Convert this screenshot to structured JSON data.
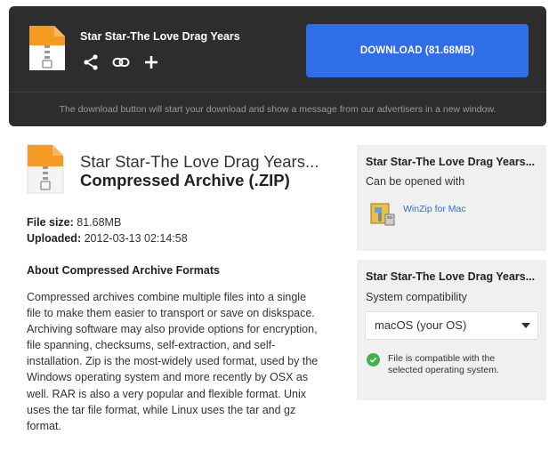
{
  "header": {
    "title": "Star Star-The Love Drag Years",
    "download_label": "DOWNLOAD (81.68MB)",
    "notice": "The download button will start your download and show a message from our advertisers in a new window.",
    "actions": [
      "share-icon",
      "link-icon",
      "plus-icon"
    ]
  },
  "file": {
    "name": "Star Star-The Love Drag Years...",
    "type": "Compressed Archive (.ZIP)",
    "size_label": "File size:",
    "size": "81.68MB",
    "uploaded_label": "Uploaded:",
    "uploaded": "2012-03-13 02:14:58"
  },
  "about": {
    "heading": "About Compressed Archive Formats",
    "body": "Compressed archives combine multiple files into a single file to make them easier to transport or save on diskspace. Archiving software may also provide options for encryption, file spanning, checksums, self-extraction, and self-installation. Zip is the most-widely used format, used by the Windows operating system and more recently by OSX as well. RAR is also a very popular and flexible format. Unix uses the tar file format, while Linux uses the tar and gz format."
  },
  "open_panel": {
    "title": "Star Star-The Love Drag Years...",
    "subtitle": "Can be opened with",
    "app": "WinZip for Mac"
  },
  "compat_panel": {
    "title": "Star Star-The Love Drag Years...",
    "subtitle": "System compatibility",
    "selected_os": "macOS (your OS)",
    "status": "File is compatible with the selected operating system."
  },
  "colors": {
    "accent": "#2f6ee8",
    "header_bg": "#2d2d2d",
    "panel_bg": "#f0f0f0",
    "success": "#3fb24a",
    "file_icon_orange": "#f59a23"
  }
}
